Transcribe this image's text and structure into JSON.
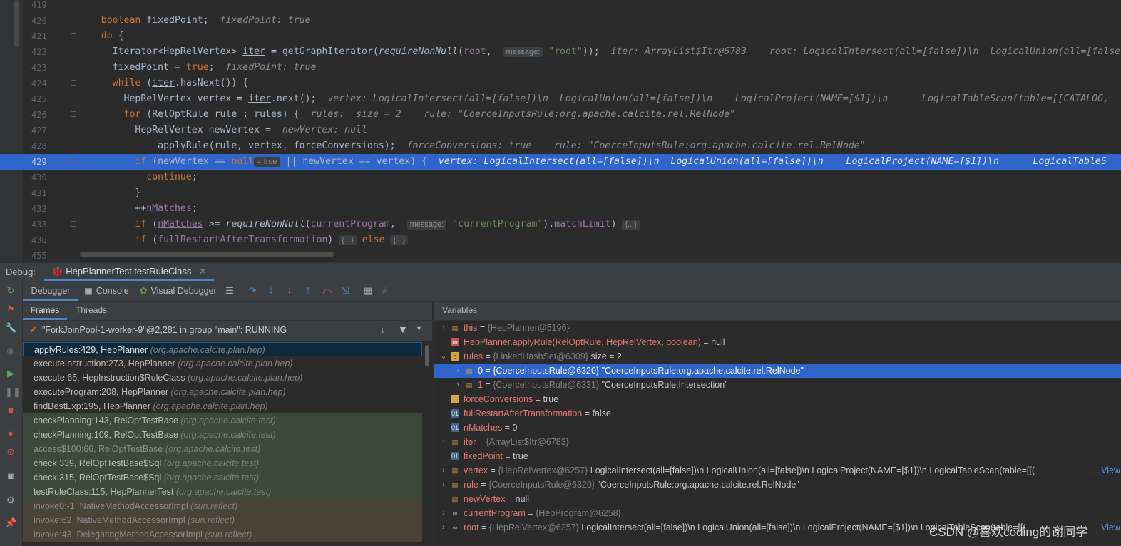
{
  "editor": {
    "lines": [
      {
        "n": "419",
        "html": ""
      },
      {
        "n": "420",
        "html": "<span class='kw'>boolean</span> <span class='ul'>fixedPoint</span>;  <span class='inl'>fixedPoint: true</span>"
      },
      {
        "n": "421",
        "html": "<span class='kw'>do</span> {"
      },
      {
        "n": "422",
        "html": "  Iterator&lt;HepRelVertex&gt; <span class='ul'>iter</span> = getGraphIterator(<span class='it'>requireNonNull</span>(<span class='var'>root</span>,  <span class='hint'>message:</span> <span class='str'>\"root\"</span>));  <span class='inl'>iter: ArrayList$Itr@6783    root: LogicalIntersect(all=[false])\\n  LogicalUnion(all=[false</span>"
      },
      {
        "n": "423",
        "html": "  <span class='ul'>fixedPoint</span> = <span class='kw'>true</span>;  <span class='inl'>fixedPoint: true</span>"
      },
      {
        "n": "424",
        "html": "  <span class='kw'>while</span> (<span class='ul'>iter</span>.hasNext()) {"
      },
      {
        "n": "425",
        "html": "    HepRelVertex vertex = <span class='ul'>iter</span>.next();  <span class='inl'>vertex: LogicalIntersect(all=[false])\\n  LogicalUnion(all=[false])\\n    LogicalProject(NAME=[$1])\\n      LogicalTableScan(table=[[CATALOG,</span>"
      },
      {
        "n": "426",
        "html": "    <span class='kw'>for</span> (RelOptRule rule : rules) {  <span class='inl'>rules:  size = 2    rule: \"CoerceInputsRule:org.apache.calcite.rel.RelNode\"</span>"
      },
      {
        "n": "427",
        "html": "      HepRelVertex newVertex =  <span class='inl'>newVertex: null</span>"
      },
      {
        "n": "428",
        "html": "          applyRule(rule, vertex, forceConversions);  <span class='inl'>forceConversions: true    rule: \"CoerceInputsRule:org.apache.calcite.rel.RelNode\"</span>"
      },
      {
        "n": "429",
        "html": "      <span class='kw'>if</span> (newVertex == <span class='kw'>null</span><span class='hint'>= true</span> || newVertex == vertex) {  <span class='inl'>vertex: LogicalIntersect(all=[false])\\n  LogicalUnion(all=[false])\\n    LogicalProject(NAME=[$1])\\n      LogicalTableS</span>",
        "sel": true
      },
      {
        "n": "430",
        "html": "        <span class='kw'>continue</span>;"
      },
      {
        "n": "431",
        "html": "      }"
      },
      {
        "n": "432",
        "html": "      ++<span class='ul var'>nMatches</span>;"
      },
      {
        "n": "433",
        "html": "      <span class='kw'>if</span> (<span class='ul var'>nMatches</span> &gt;= <span class='it'>requireNonNull</span>(<span class='var'>currentProgram</span>,  <span class='hint'>message:</span> <span class='str'>\"currentProgram\"</span>).<span class='var'>matchLimit</span>) <span class='hint'>{...}</span>"
      },
      {
        "n": "436",
        "html": "      <span class='kw'>if</span> (<span class='var'>fullRestartAfterTransformation</span>) <span class='hint'>{...}</span> <span class='kw'>else</span> <span class='hint'>{...}</span>"
      },
      {
        "n": "455",
        "html": ""
      }
    ]
  },
  "debug": {
    "title_label": "Debug:",
    "session_tab": "HepPlannerTest.testRuleClass",
    "tabs": [
      "Debugger",
      "Console",
      "Visual Debugger"
    ],
    "frames_tab": "Frames",
    "threads_tab": "Threads",
    "variables_title": "Variables",
    "thread": "\"ForkJoinPool-1-worker-9\"@2,281 in group \"main\": RUNNING",
    "frames": [
      {
        "m": "applyRules:429, HepPlanner",
        "p": "(org.apache.calcite.plan.hep)",
        "k": "sel"
      },
      {
        "m": "executeInstruction:273, HepPlanner",
        "p": "(org.apache.calcite.plan.hep)",
        "k": ""
      },
      {
        "m": "execute:65, HepInstruction$RuleClass",
        "p": "(org.apache.calcite.plan.hep)",
        "k": ""
      },
      {
        "m": "executeProgram:208, HepPlanner",
        "p": "(org.apache.calcite.plan.hep)",
        "k": ""
      },
      {
        "m": "findBestExp:195, HepPlanner",
        "p": "(org.apache.calcite.plan.hep)",
        "k": ""
      },
      {
        "m": "checkPlanning:143, RelOptTestBase",
        "p": "(org.apache.calcite.test)",
        "k": "lib"
      },
      {
        "m": "checkPlanning:109, RelOptTestBase",
        "p": "(org.apache.calcite.test)",
        "k": "lib"
      },
      {
        "m": "access$100:66, RelOptTestBase",
        "p": "(org.apache.calcite.test)",
        "k": "lib dim"
      },
      {
        "m": "check:339, RelOptTestBase$Sql",
        "p": "(org.apache.calcite.test)",
        "k": "lib"
      },
      {
        "m": "check:315, RelOptTestBase$Sql",
        "p": "(org.apache.calcite.test)",
        "k": "lib"
      },
      {
        "m": "testRuleClass:115, HepPlannerTest",
        "p": "(org.apache.calcite.test)",
        "k": "lib"
      },
      {
        "m": "invoke0:-1, NativeMethodAccessorImpl",
        "p": "(sun.reflect)",
        "k": "lib2 dim"
      },
      {
        "m": "invoke:62, NativeMethodAccessorImpl",
        "p": "(sun.reflect)",
        "k": "lib2 dim"
      },
      {
        "m": "invoke:43, DelegatingMethodAccessorImpl",
        "p": "(sun.reflect)",
        "k": "lib2 dim"
      }
    ],
    "variables": [
      {
        "lvl": 0,
        "arrow": "›",
        "icon": "field",
        "name": "this",
        "ref": "{HepPlanner@5196}",
        "val": ""
      },
      {
        "lvl": 0,
        "arrow": "",
        "icon": "method",
        "name": "HepPlanner.applyRule(RelOptRule, HepRelVertex, boolean)",
        "ref": "",
        "val": " = null"
      },
      {
        "lvl": 0,
        "arrow": "⌄",
        "icon": "param",
        "name": "rules",
        "ref": "{LinkedHashSet@6309}",
        "val": "  size = 2"
      },
      {
        "lvl": 1,
        "arrow": "›",
        "icon": "field",
        "name": "0",
        "ref": "{CoerceInputsRule@6320}",
        "val": " \"CoerceInputsRule:org.apache.calcite.rel.RelNode\"",
        "sel": true
      },
      {
        "lvl": 1,
        "arrow": "›",
        "icon": "field",
        "name": "1",
        "ref": "{CoerceInputsRule@6331}",
        "val": " \"CoerceInputsRule:Intersection\""
      },
      {
        "lvl": 0,
        "arrow": "",
        "icon": "param",
        "name": "forceConversions",
        "ref": "",
        "val": " = true"
      },
      {
        "lvl": 0,
        "arrow": "",
        "icon": "prim",
        "name": "fullRestartAfterTransformation",
        "ref": "",
        "val": " = false"
      },
      {
        "lvl": 0,
        "arrow": "",
        "icon": "prim",
        "name": "nMatches",
        "ref": "",
        "val": " = 0"
      },
      {
        "lvl": 0,
        "arrow": "›",
        "icon": "field",
        "name": "iter",
        "ref": "{ArrayList$Itr@6783}",
        "val": ""
      },
      {
        "lvl": 0,
        "arrow": "",
        "icon": "prim",
        "name": "fixedPoint",
        "ref": "",
        "val": " = true"
      },
      {
        "lvl": 0,
        "arrow": "›",
        "icon": "field",
        "name": "vertex",
        "ref": "{HepRelVertex@6257}",
        "val": " LogicalIntersect(all=[false])\\n  LogicalUnion(all=[false])\\n    LogicalProject(NAME=[$1])\\n      LogicalTableScan(table=[[(",
        "link": "... View"
      },
      {
        "lvl": 0,
        "arrow": "›",
        "icon": "field",
        "name": "rule",
        "ref": "{CoerceInputsRule@6320}",
        "val": " \"CoerceInputsRule:org.apache.calcite.rel.RelNode\""
      },
      {
        "lvl": 0,
        "arrow": "",
        "icon": "field",
        "name": "newVertex",
        "ref": "",
        "val": " = null"
      },
      {
        "lvl": 0,
        "arrow": "›",
        "icon": "watch",
        "name": "currentProgram",
        "ref": "{HepProgram@6258}",
        "val": ""
      },
      {
        "lvl": 0,
        "arrow": "›",
        "icon": "watch",
        "name": "root",
        "ref": "{HepRelVertex@6257}",
        "val": " LogicalIntersect(all=[false])\\n  LogicalUnion(all=[false])\\n    LogicalProject(NAME=[$1])\\n      LogicalTableScan(table=[[(",
        "link": "... View"
      }
    ]
  },
  "watermark": "CSDN @喜欢coding的谢同学",
  "colors": {
    "accent": "#4a88c7",
    "selection": "#2f65ca",
    "keyword": "#cc7832",
    "string": "#6a8759"
  }
}
